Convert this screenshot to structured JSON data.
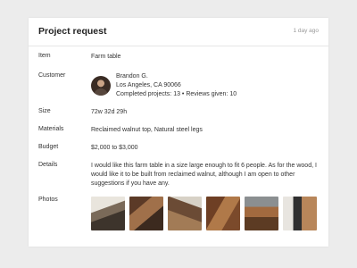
{
  "header": {
    "title": "Project request",
    "time_ago": "1 day ago"
  },
  "fields": {
    "item": {
      "label": "Item",
      "value": "Farm table"
    },
    "customer": {
      "label": "Customer",
      "name": "Brandon G.",
      "location": "Los Angeles, CA 90066",
      "stats": "Completed projects: 13 • Reviews given: 10"
    },
    "size": {
      "label": "Size",
      "value": "72w 32d 29h"
    },
    "materials": {
      "label": "Materials",
      "value": "Reclaimed walnut top, Natural steel legs"
    },
    "budget": {
      "label": "Budget",
      "value": "$2,000 to $3,000"
    },
    "details": {
      "label": "Details",
      "value": "I would like this farm table in a size large enough to fit 6 people. As for the wood, I would like it to be built from reclaimed walnut, although I am open to other suggestions if you have any."
    },
    "photos": {
      "label": "Photos",
      "count": 6
    }
  }
}
